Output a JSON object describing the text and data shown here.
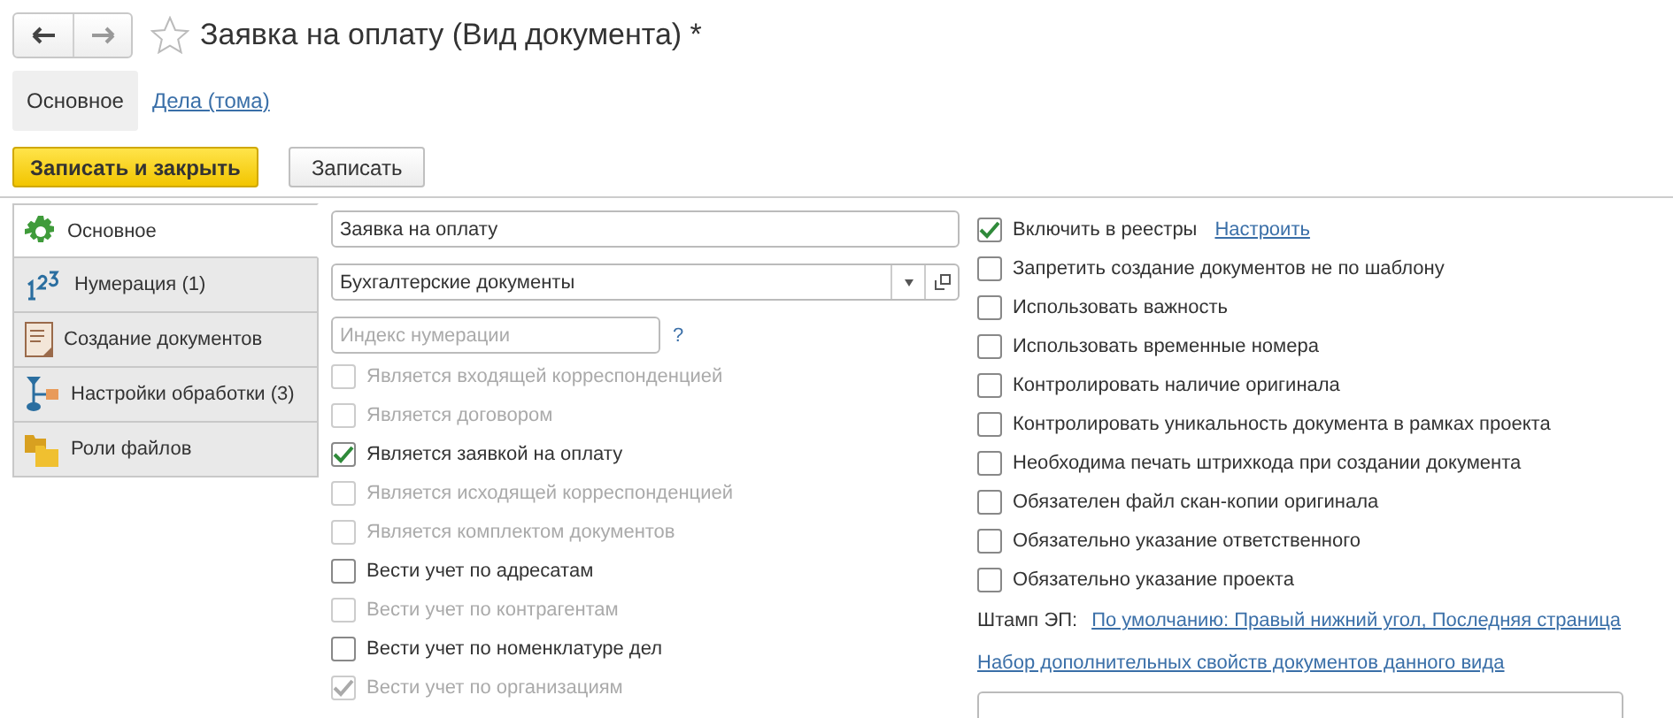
{
  "window": {
    "title": "Заявка на оплату (Вид документа) *",
    "favorite": false
  },
  "nav_tabs": [
    {
      "label": "Основное",
      "selected": true
    },
    {
      "label": "Дела (тома)",
      "selected": false
    }
  ],
  "toolbar": [
    {
      "label": "Записать и закрыть",
      "kind": "primary"
    },
    {
      "label": "Записать",
      "kind": "normal"
    }
  ],
  "side_tabs": [
    {
      "label": "Основное",
      "selected": true
    },
    {
      "label": "Нумерация (1)",
      "selected": false
    },
    {
      "label": "Создание документов",
      "selected": false
    },
    {
      "label": "Настройки обработки (3)",
      "selected": false
    },
    {
      "label": "Роли файлов",
      "selected": false
    }
  ],
  "name_field": {
    "value": "Заявка на оплату"
  },
  "group_field": {
    "value": "Бухгалтерские документы"
  },
  "index_field": {
    "placeholder": "Индекс нумерации",
    "help": "?"
  },
  "left_options": [
    {
      "label": "Является входящей корреспонденцией",
      "checked": false,
      "disabled": true
    },
    {
      "label": "Является договором",
      "checked": false,
      "disabled": true
    },
    {
      "label": "Является заявкой на оплату",
      "checked": true,
      "disabled": false
    },
    {
      "label": "Является исходящей корреспонденцией",
      "checked": false,
      "disabled": true
    },
    {
      "label": "Является комплектом документов",
      "checked": false,
      "disabled": true
    },
    {
      "label": "Вести учет по адресатам",
      "checked": false,
      "disabled": false
    },
    {
      "label": "Вести учет по контрагентам",
      "checked": false,
      "disabled": true
    },
    {
      "label": "Вести учет по номенклатуре дел",
      "checked": false,
      "disabled": false
    },
    {
      "label": "Вести учет по организациям",
      "checked": true,
      "disabled": true
    }
  ],
  "right_options": [
    {
      "label": "Включить в реестры",
      "checked": true,
      "disabled": false,
      "link": "Настроить"
    },
    {
      "label": "Запретить создание документов не по шаблону",
      "checked": false,
      "disabled": false
    },
    {
      "label": "Использовать важность",
      "checked": false,
      "disabled": false
    },
    {
      "label": "Использовать временные номера",
      "checked": false,
      "disabled": false
    },
    {
      "label": "Контролировать наличие оригинала",
      "checked": false,
      "disabled": false
    },
    {
      "label": "Контролировать уникальность документа в рамках проекта",
      "checked": false,
      "disabled": false
    },
    {
      "label": "Необходима печать штрихкода при создании документа",
      "checked": false,
      "disabled": false
    },
    {
      "label": "Обязателен файл скан-копии оригинала",
      "checked": false,
      "disabled": false
    },
    {
      "label": "Обязательно указание ответственного",
      "checked": false,
      "disabled": false
    },
    {
      "label": "Обязательно указание проекта",
      "checked": false,
      "disabled": false
    }
  ],
  "stamp": {
    "label": "Штамп ЭП:",
    "value": "По умолчанию: Правый нижний угол, Последняя страница"
  },
  "properties_link": "Набор дополнительных свойств документов данного вида"
}
